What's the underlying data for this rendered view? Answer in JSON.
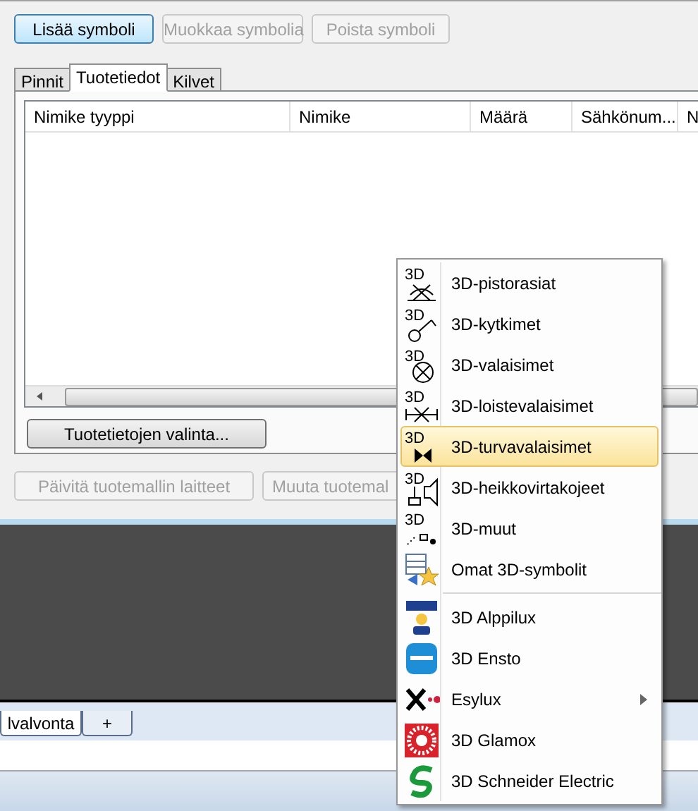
{
  "toolbar": {
    "buttons": [
      {
        "label": "Lisää symboli",
        "disabled": false
      },
      {
        "label": "Muokkaa symbolia",
        "disabled": true
      },
      {
        "label": "Poista symboli",
        "disabled": true
      }
    ]
  },
  "tabs": [
    {
      "label": "Pinnit",
      "selected": false
    },
    {
      "label": "Tuotetiedot",
      "selected": true
    },
    {
      "label": "Kilvet",
      "selected": false
    }
  ],
  "table": {
    "columns": [
      "Nimike tyyppi",
      "Nimike",
      "Määrä",
      "Sähkönum...",
      "N"
    ]
  },
  "select_button": {
    "label": "Tuotetietojen valinta...",
    "disabled": false
  },
  "bottom_buttons": [
    {
      "label": "Päivitä tuotemallin laitteet",
      "disabled": true
    },
    {
      "label": "Muuta tuotemal",
      "disabled": true
    }
  ],
  "sheet_tabs": [
    {
      "label": "lvalvonta",
      "selected": true
    },
    {
      "label": "+",
      "selected": false
    }
  ],
  "menu": {
    "groups": [
      [
        {
          "label": "3D-pistorasiat",
          "icon_text": "3D",
          "selected": false,
          "has_submenu": false
        },
        {
          "label": "3D-kytkimet",
          "icon_text": "3D",
          "selected": false,
          "has_submenu": false
        },
        {
          "label": "3D-valaisimet",
          "icon_text": "3D",
          "selected": false,
          "has_submenu": false
        },
        {
          "label": "3D-loistevalaisimet",
          "icon_text": "3D",
          "selected": false,
          "has_submenu": false
        },
        {
          "label": "3D-turvavalaisimet",
          "icon_text": "3D",
          "selected": true,
          "has_submenu": false
        },
        {
          "label": "3D-heikkovirtakojeet",
          "icon_text": "3D",
          "selected": false,
          "has_submenu": false
        },
        {
          "label": "3D-muut",
          "icon_text": "3D",
          "selected": false,
          "has_submenu": false
        },
        {
          "label": "Omat 3D-symbolit",
          "selected": false,
          "has_submenu": false
        }
      ],
      [
        {
          "label": "3D Alppilux",
          "selected": false,
          "has_submenu": false
        },
        {
          "label": "3D Ensto",
          "selected": false,
          "has_submenu": false
        },
        {
          "label": "Esylux",
          "selected": false,
          "has_submenu": true
        },
        {
          "label": "3D Glamox",
          "selected": false,
          "has_submenu": false
        },
        {
          "label": "3D Schneider Electric",
          "selected": false,
          "has_submenu": false
        }
      ]
    ]
  }
}
